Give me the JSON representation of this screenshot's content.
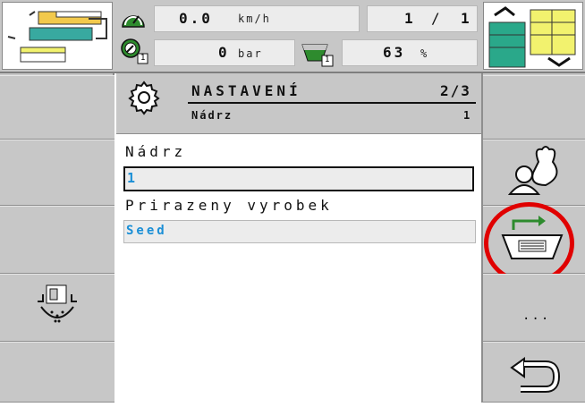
{
  "topbar": {
    "speed_value": "0.0",
    "speed_unit": "km/h",
    "pressure_value": "0",
    "pressure_unit": "bar",
    "section_left": "1",
    "section_sep": "/",
    "section_right": "1",
    "tank_percent": "63",
    "tank_percent_unit": "%",
    "tank_index": "1",
    "pressure_index": "1"
  },
  "header": {
    "title": "NASTAVENÍ",
    "page": "2/3",
    "subtitle": "Nádrz",
    "sub_index": "1"
  },
  "form": {
    "tank_label": "Nádrz",
    "tank_value": "1",
    "product_label": "Prirazeny vyrobek",
    "product_value": "Seed"
  },
  "sidebar_right": {
    "more_label": "..."
  },
  "colors": {
    "accent_blue": "#1b8fd6",
    "highlight_red": "#e00000",
    "sidebar_gray": "#c7c7c7",
    "icon_green": "#2e8b2e"
  }
}
